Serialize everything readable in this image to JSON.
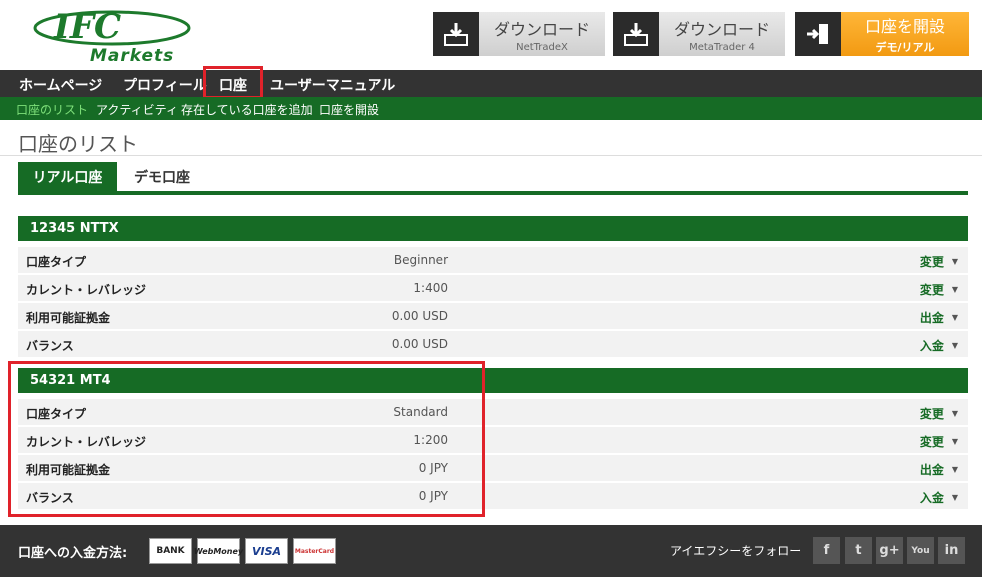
{
  "header": {
    "logo_text": "IFC",
    "logo_subtext": "Markets",
    "download_buttons": [
      {
        "title": "ダウンロード",
        "subtitle": "NetTradeX"
      },
      {
        "title": "ダウンロード",
        "subtitle": "MetaTrader 4"
      }
    ],
    "open_account": {
      "title": "口座を開設",
      "subtitle": "デモ/リアル"
    }
  },
  "main_nav": {
    "items": [
      {
        "label": "ホームページ"
      },
      {
        "label": "プロフィール"
      },
      {
        "label": "口座"
      },
      {
        "label": "ユーザーマニュアル"
      }
    ]
  },
  "sub_nav": {
    "items": [
      {
        "label": "口座のリスト"
      },
      {
        "label": "アクティビティ"
      },
      {
        "label": "存在している口座を追加"
      },
      {
        "label": "口座を開設"
      }
    ]
  },
  "page_title": "口座のリスト",
  "tabs": [
    {
      "label": "リアル口座"
    },
    {
      "label": "デモ口座"
    }
  ],
  "accounts": [
    {
      "header": "12345 NTTX",
      "rows": [
        {
          "label": "口座タイプ",
          "value": "Beginner",
          "action": "変更"
        },
        {
          "label": "カレント・レバレッジ",
          "value": "1:400",
          "action": "変更"
        },
        {
          "label": "利用可能証拠金",
          "value": "0.00 USD",
          "action": "出金"
        },
        {
          "label": "バランス",
          "value": "0.00 USD",
          "action": "入金"
        }
      ]
    },
    {
      "header": "54321 MT4",
      "rows": [
        {
          "label": "口座タイプ",
          "value": "Standard",
          "action": "変更"
        },
        {
          "label": "カレント・レバレッジ",
          "value": "1:200",
          "action": "変更"
        },
        {
          "label": "利用可能証拠金",
          "value": "0 JPY",
          "action": "出金"
        },
        {
          "label": "バランス",
          "value": "0 JPY",
          "action": "入金"
        }
      ]
    }
  ],
  "footer": {
    "funding_label": "口座への入金方法:",
    "payment_methods": [
      "BANK",
      "WebMoney",
      "VISA",
      "MasterCard"
    ],
    "follow_label": "アイエフシーをフォロー",
    "social": [
      "f",
      "t",
      "g+",
      "You",
      "in"
    ]
  },
  "colors": {
    "brand_green": "#166b25",
    "nav_dark": "#333333",
    "highlight_red": "#e0222a",
    "orange": "#f29a12"
  }
}
